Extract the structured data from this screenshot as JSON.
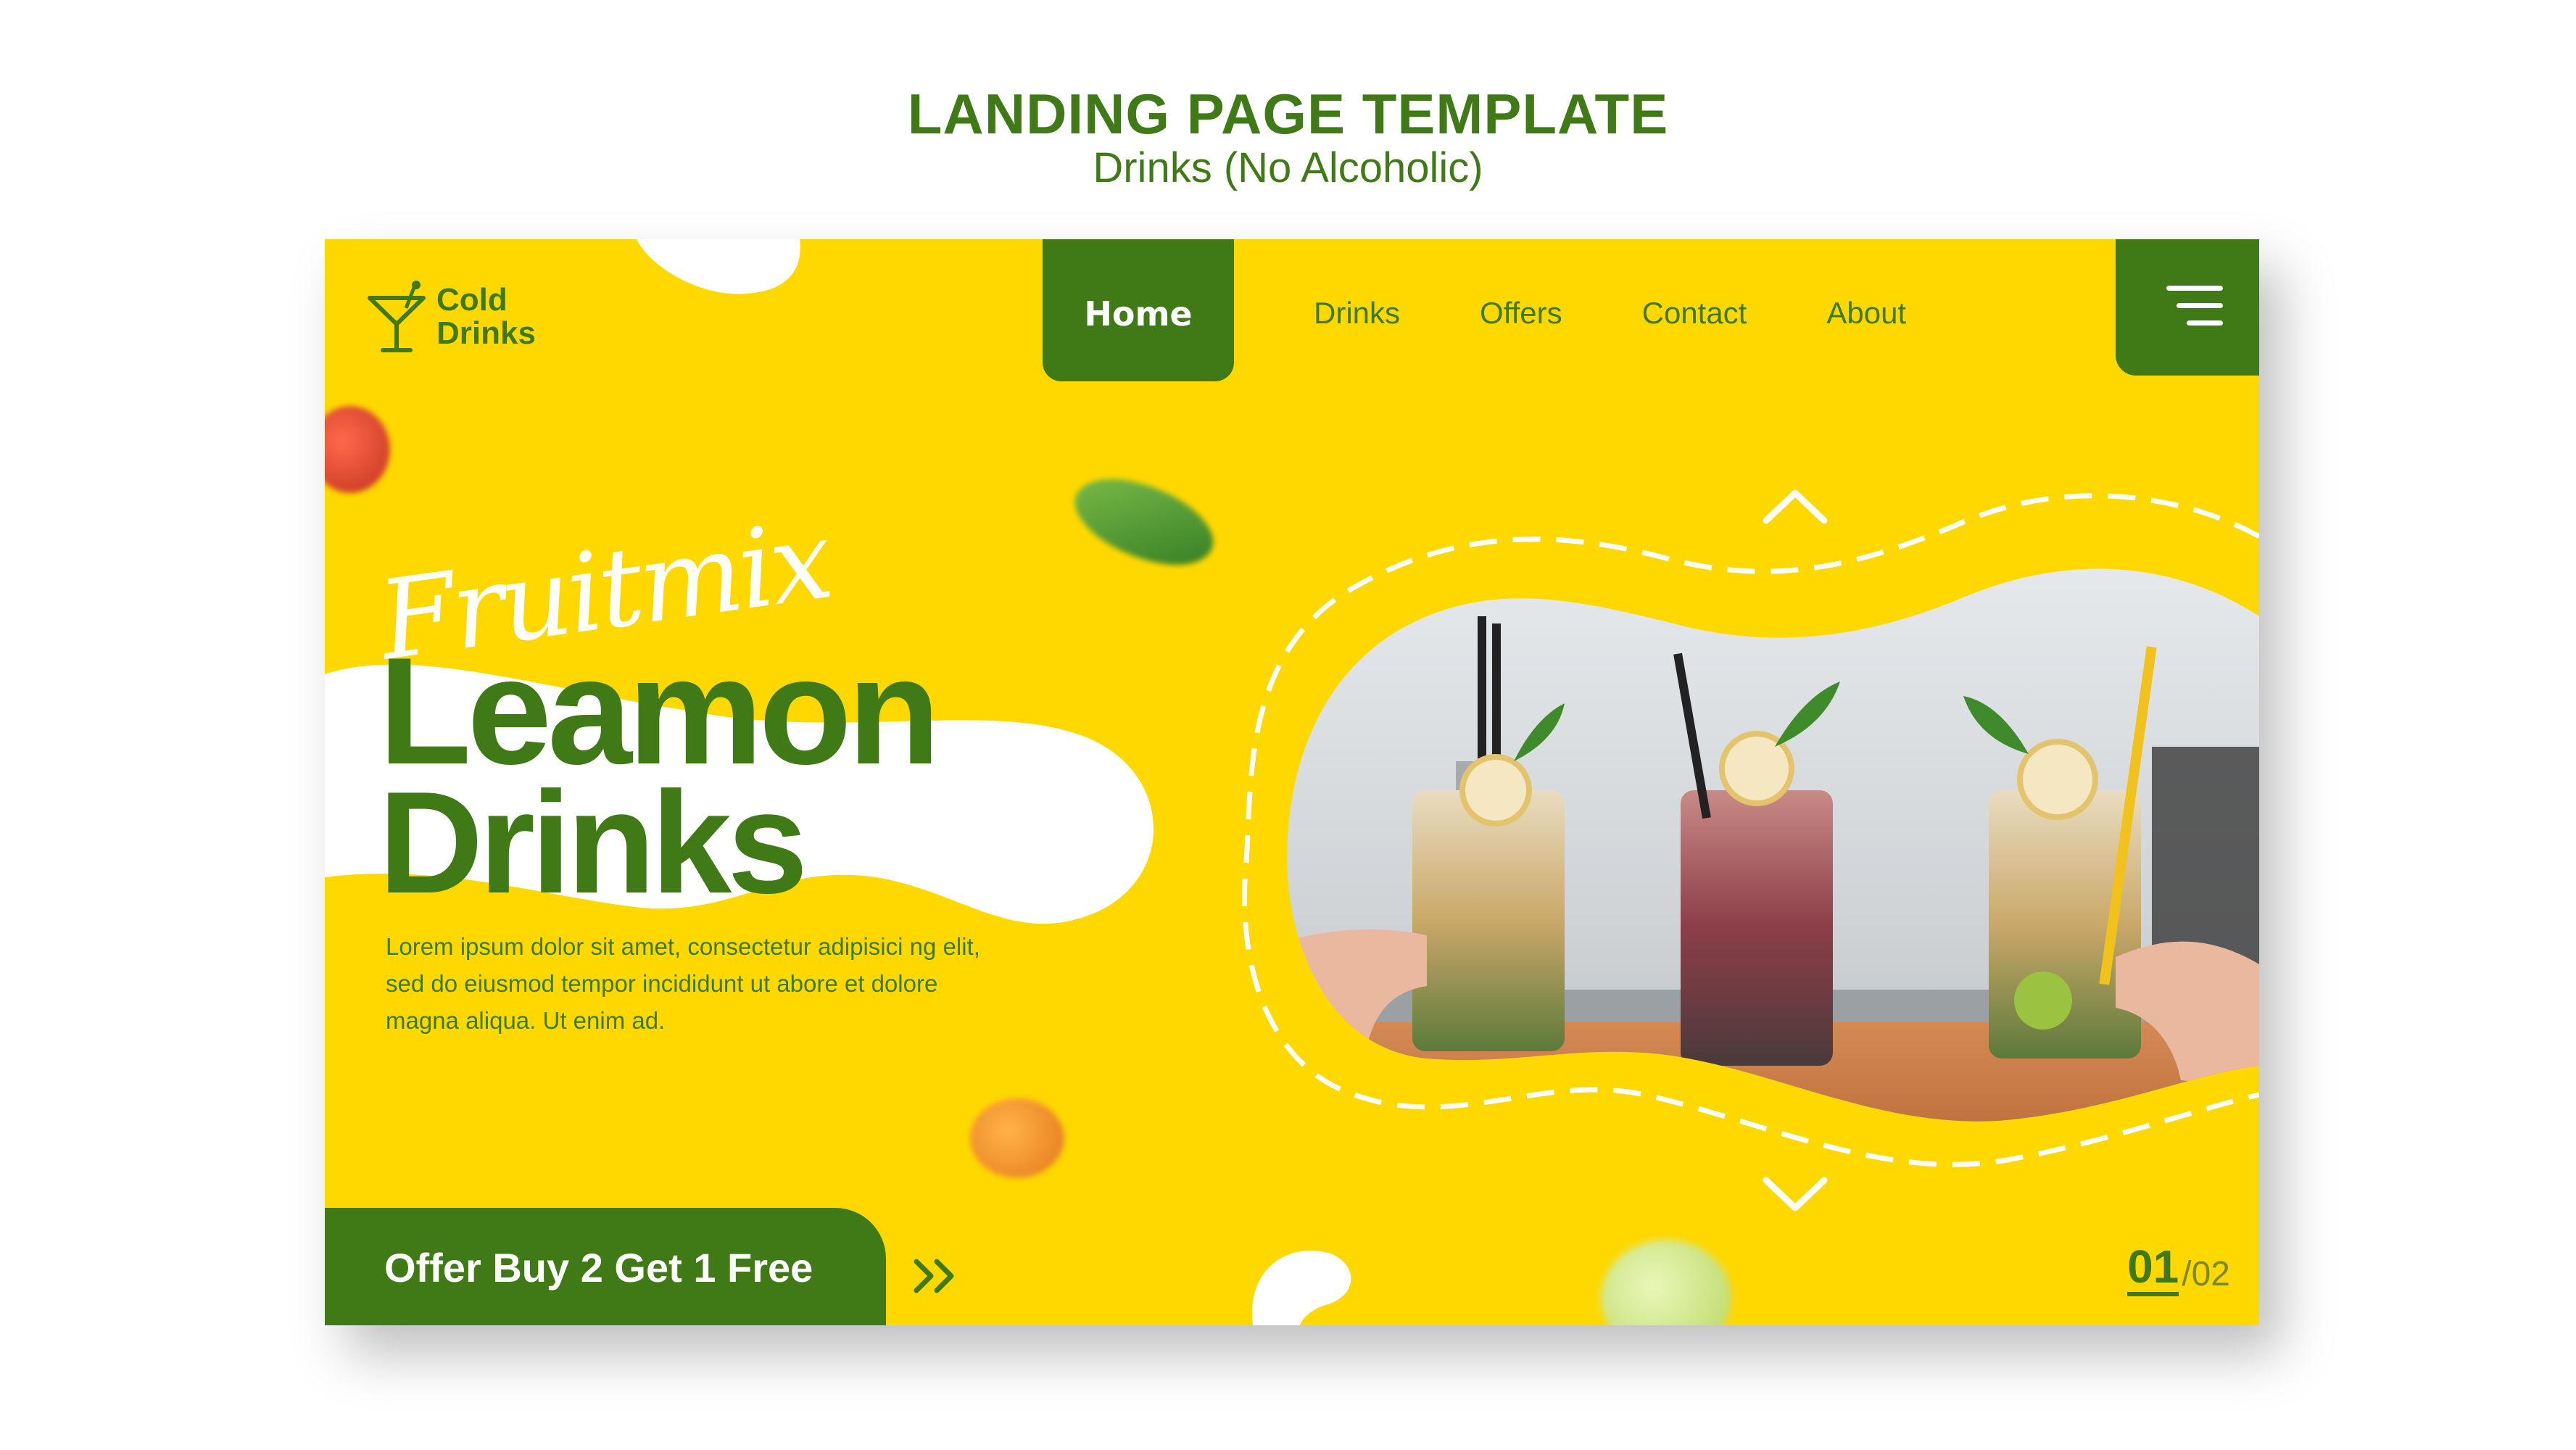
{
  "page_header": {
    "title": "LANDING PAGE TEMPLATE",
    "subtitle": "Drinks (No Alcoholic)"
  },
  "logo": {
    "line1": "Cold",
    "line2": "Drinks",
    "icon": "cocktail-glass-icon"
  },
  "nav": {
    "items": [
      {
        "label": "Home",
        "active": true
      },
      {
        "label": "Drinks"
      },
      {
        "label": "Offers"
      },
      {
        "label": "Contact"
      },
      {
        "label": "About"
      }
    ],
    "menu_icon": "hamburger-menu-icon"
  },
  "hero": {
    "script_word": "Fruitmix",
    "headline_line1": "Leamon",
    "headline_line2": "Drinks",
    "body": "Lorem ipsum dolor sit amet, consectetur adipisici ng elit, sed do eiusmod tempor incididunt ut abore et dolore magna aliqua. Ut enim ad."
  },
  "offer": {
    "label": "Offer Buy 2 Get 1 Free",
    "arrow_icon": "double-chevron-right-icon"
  },
  "slider": {
    "current": "01",
    "total": "/02",
    "up_icon": "chevron-up-icon",
    "down_icon": "chevron-down-icon"
  },
  "colors": {
    "brand_green": "#3f7a17",
    "brand_yellow": "#ffd800",
    "white": "#ffffff"
  }
}
